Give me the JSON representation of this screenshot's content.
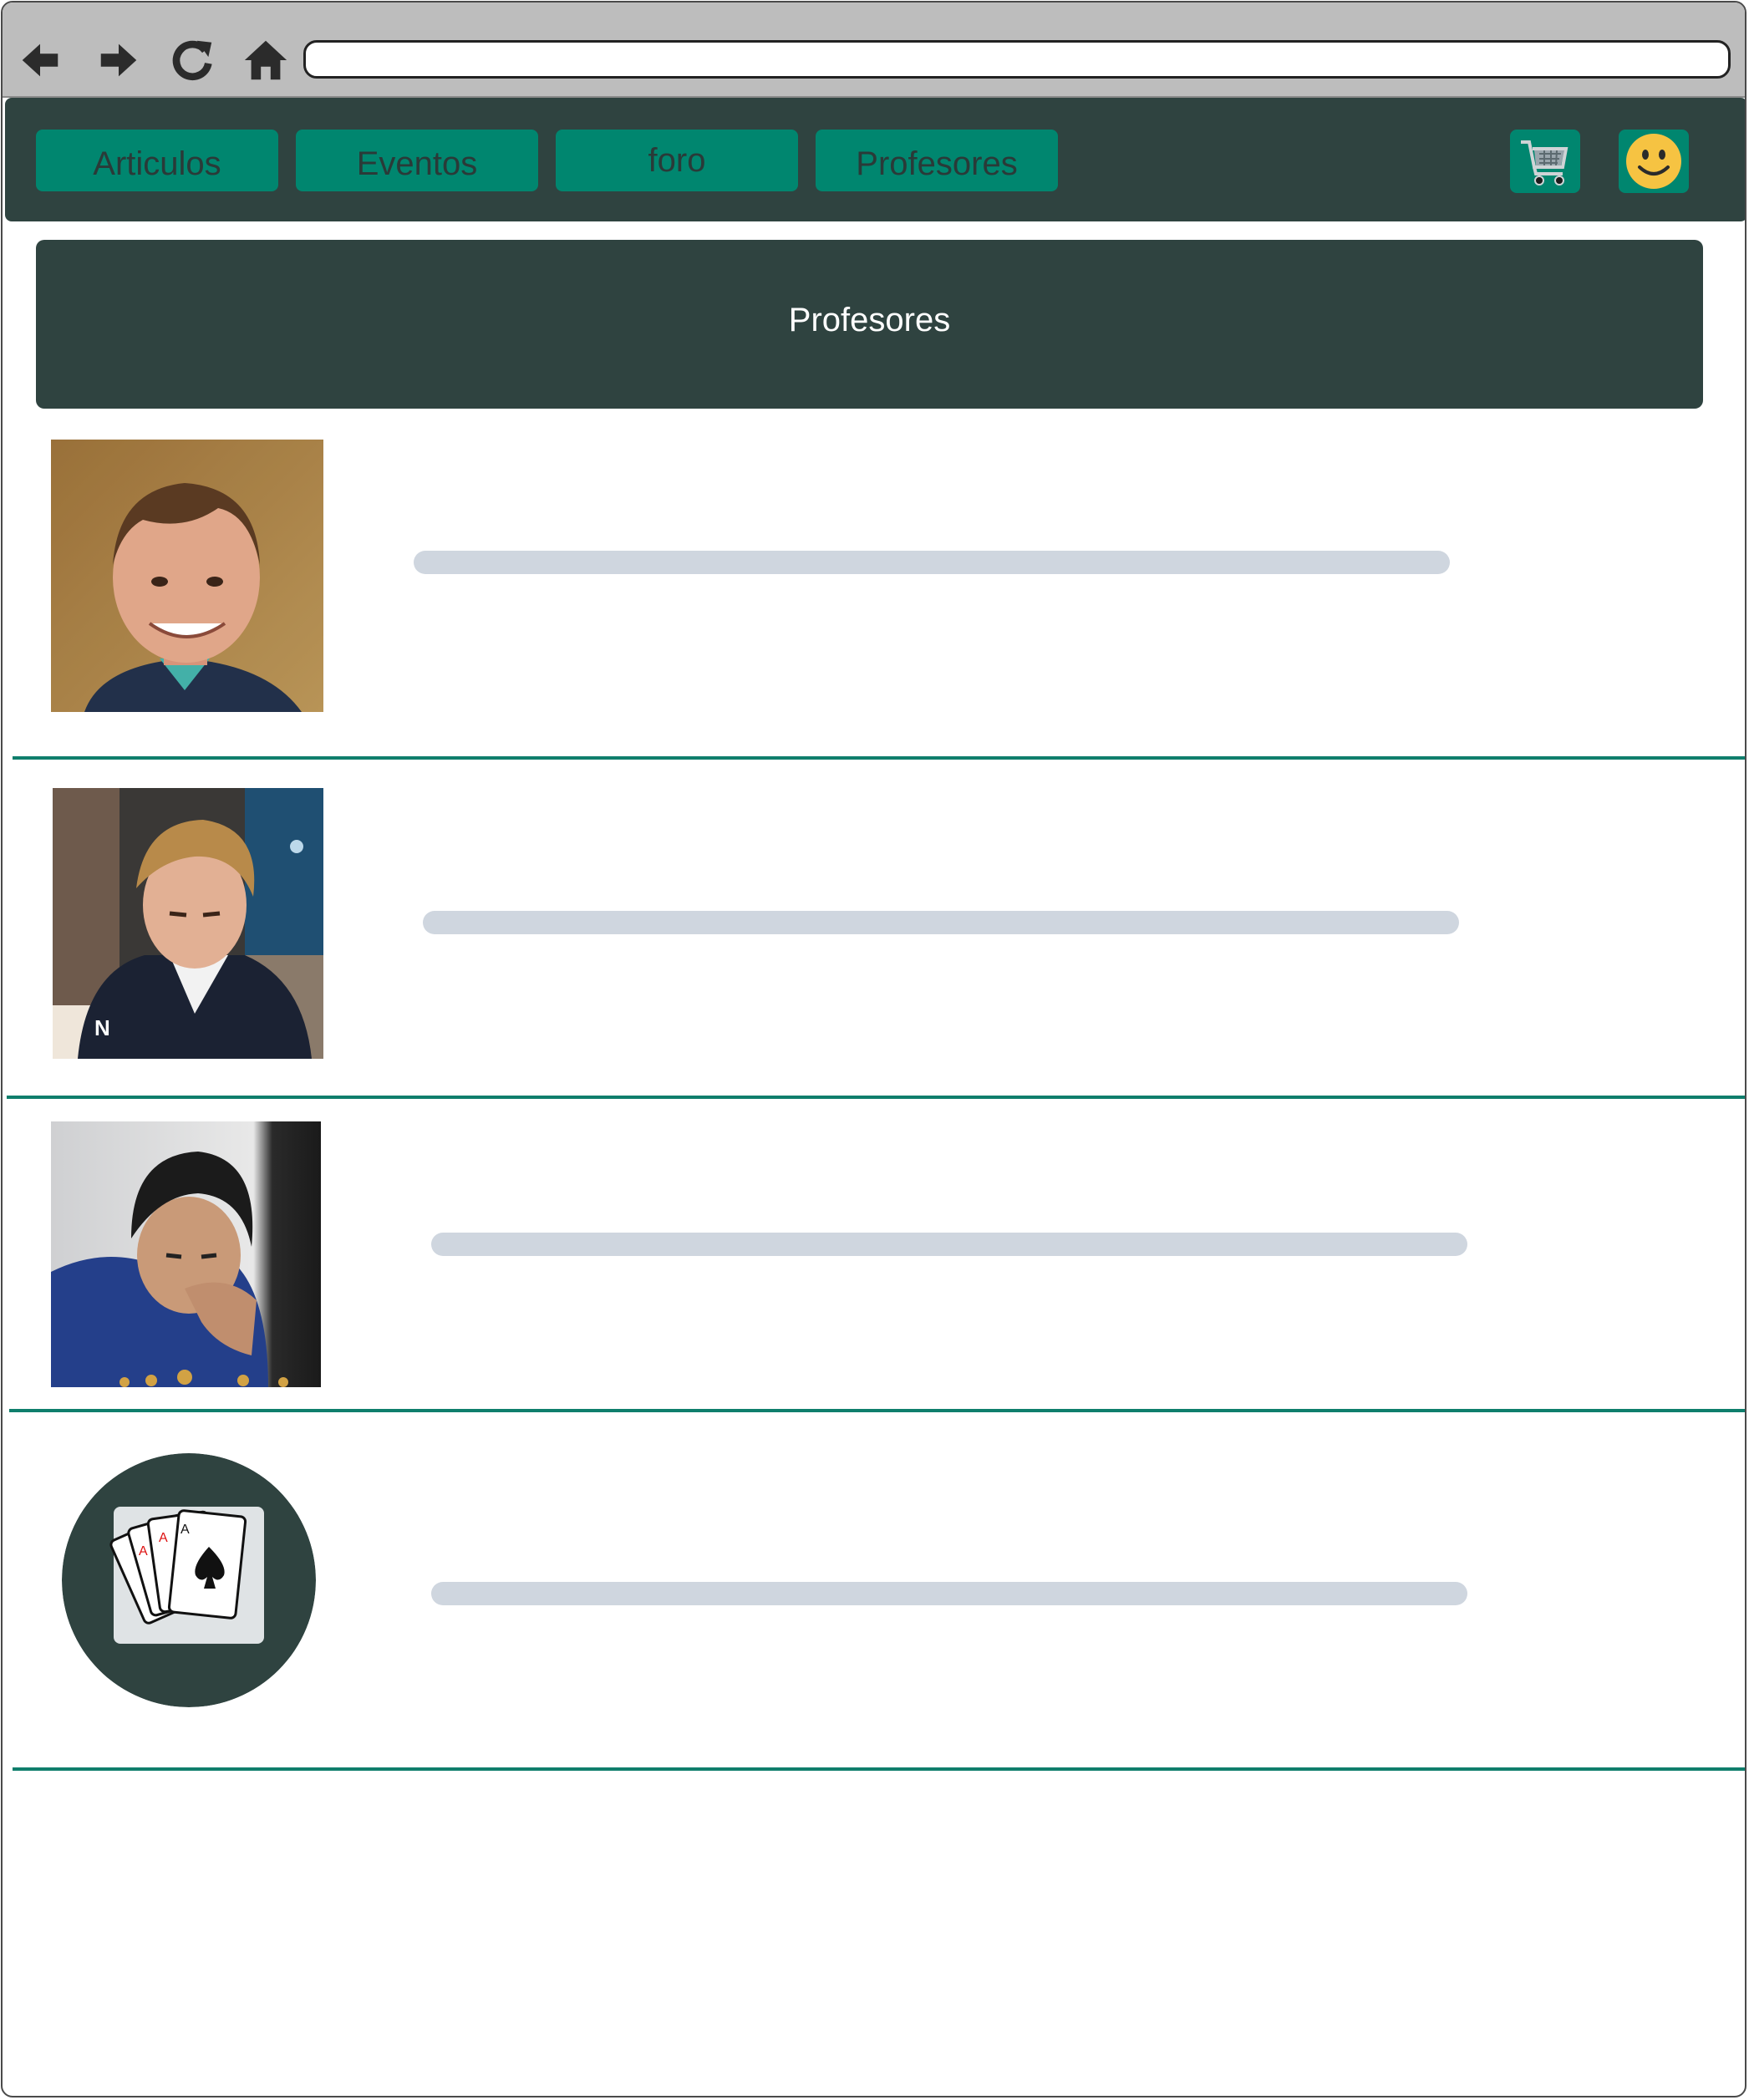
{
  "browser": {
    "back_icon": "arrow-left-icon",
    "forward_icon": "arrow-right-icon",
    "reload_icon": "reload-icon",
    "home_icon": "home-icon",
    "address_value": ""
  },
  "nav": {
    "tabs": [
      {
        "label": "Articulos"
      },
      {
        "label": "Eventos"
      },
      {
        "label": "foro"
      },
      {
        "label": "Profesores"
      }
    ],
    "cart_icon": "cart-icon",
    "profile_icon": "smiley-icon"
  },
  "page": {
    "title": "Profesores"
  },
  "teachers": [
    {
      "photo": "teacher-photo-man-smiling",
      "name_placeholder": "text-placeholder"
    },
    {
      "photo": "teacher-photo-man-blazer",
      "name_placeholder": "text-placeholder"
    },
    {
      "photo": "teacher-photo-man-thinking",
      "name_placeholder": "text-placeholder"
    },
    {
      "photo": "poker-cards-avatar",
      "name_placeholder": "text-placeholder"
    }
  ],
  "colors": {
    "navbar_bg": "#2f4340",
    "tab_bg": "#00866f",
    "separator": "#0f7e6c",
    "placeholder_bar": "#cfd6df"
  }
}
